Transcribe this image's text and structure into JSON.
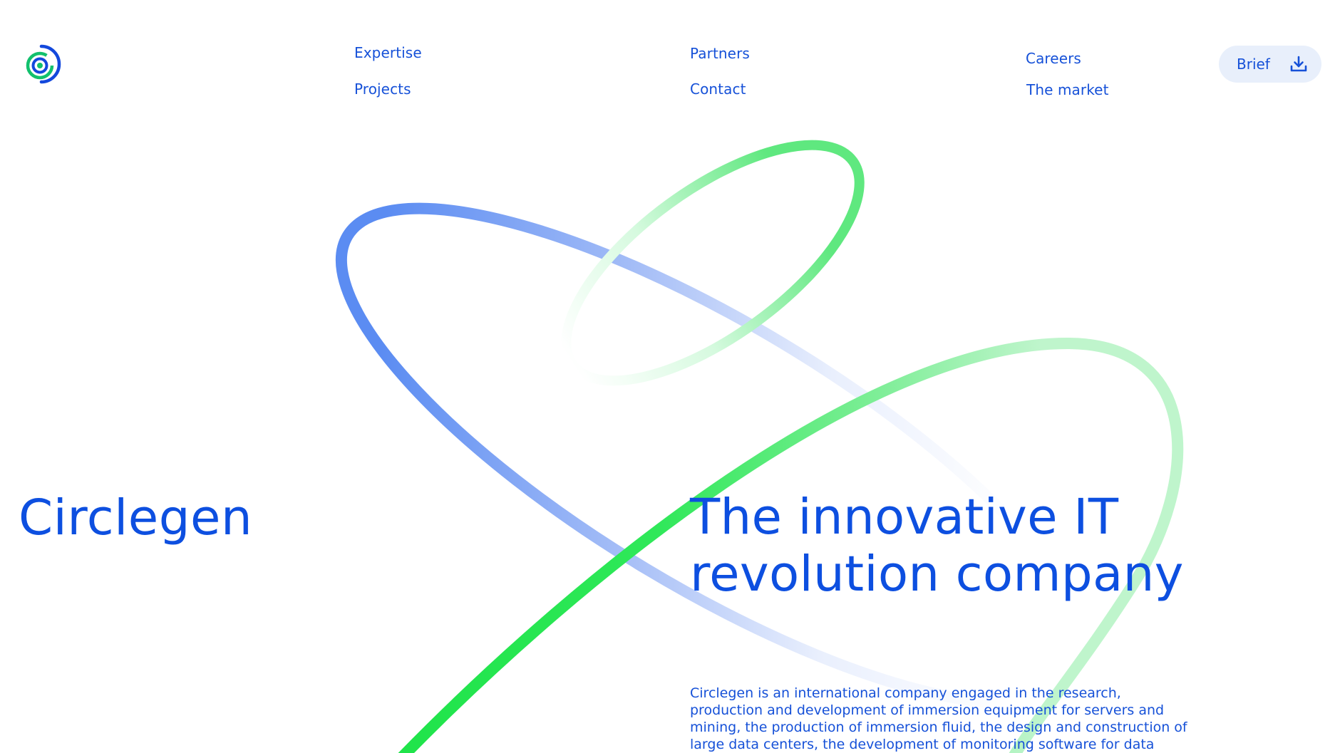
{
  "brand": {
    "logo_icon": "circlegen-logo-icon",
    "name": "Circlegen"
  },
  "nav": {
    "expertise": "Expertise",
    "projects": "Projects",
    "partners": "Partners",
    "contact": "Contact",
    "careers": "Careers",
    "market": "The market"
  },
  "brief_button": {
    "label": "Brief",
    "icon": "download-icon"
  },
  "hero": {
    "headline_line1": "The innovative IT",
    "headline_line2": "revolution company",
    "description": "Circlegen is an international company engaged in the research, production and development of immersion equipment for servers and mining, the production of immersion fluid, the design and construction of large data centers, the development of monitoring software for data centers, the"
  },
  "colors": {
    "brand_blue": "#0d4fe0",
    "brand_green": "#1fe44a",
    "button_bg": "#e8effb",
    "background": "#ffffff"
  }
}
